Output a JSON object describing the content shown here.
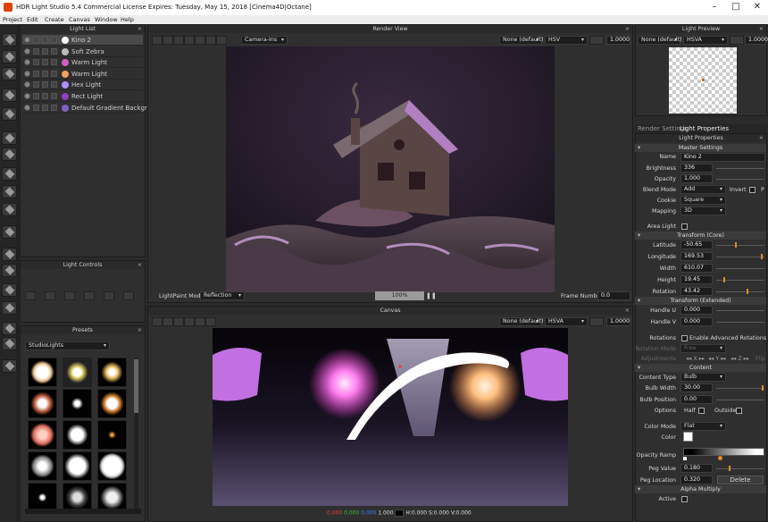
{
  "window": {
    "title": "HDR Light Studio 5.4 Commercial License Expires: Tuesday, May 15, 2018  [Cinema4D|Octane]"
  },
  "menu": [
    "Project",
    "Edit",
    "Create",
    "Canvas",
    "Window",
    "Help"
  ],
  "light_list": {
    "title": "Light List",
    "items": [
      {
        "name": "Kino 2",
        "color": "#ffffff",
        "selected": true
      },
      {
        "name": "Soft Zebra",
        "color": "#bbbbbb",
        "selected": false
      },
      {
        "name": "Warm Light",
        "color": "#d060c0",
        "selected": false
      },
      {
        "name": "Warm Light",
        "color": "#f0a060",
        "selected": false
      },
      {
        "name": "Hex Light",
        "color": "#b090ff",
        "selected": false
      },
      {
        "name": "Rect Light",
        "color": "#9040c0",
        "selected": false
      },
      {
        "name": "Default Gradient Background",
        "color": "#8060c0",
        "selected": false
      }
    ]
  },
  "light_controls": {
    "title": "Light Controls"
  },
  "presets": {
    "title": "Presets",
    "category": "StudioLights"
  },
  "render_view": {
    "title": "Render View",
    "camera": "Camera-Ins",
    "lut": "None (default)",
    "colorspace": "HSV",
    "exposure": "1.0000",
    "lightpaint_label": "LightPaint Mode",
    "lightpaint_mode": "Reflection",
    "progress": "100%",
    "frame_label": "Frame Number",
    "frame_value": "0.0"
  },
  "canvas": {
    "title": "Canvas",
    "lut": "None (default)",
    "colorspace": "HSVA",
    "exposure": "1.0000",
    "readout_r": "0.000",
    "readout_g": "0.000",
    "readout_b": "0.000",
    "readout_a": "1.000",
    "readout_hsv": "H:0.000 S:0.000 V:0.000"
  },
  "light_preview": {
    "title": "Light Preview",
    "lut": "None (default)",
    "colorspace": "HSVA",
    "exposure": "1.0000"
  },
  "tabs": [
    "Render Settings",
    "Light Properties"
  ],
  "props": {
    "title": "Light Properties",
    "master": "Master Settings",
    "name_label": "Name",
    "name": "Kino 2",
    "brightness_label": "Brightness",
    "brightness": "336",
    "opacity_label": "Opacity",
    "opacity": "1.000",
    "blend_label": "Blend Mode",
    "blend": "Add",
    "invert_label": "Invert",
    "p_label": "P",
    "cookie_label": "Cookie",
    "cookie": "Square",
    "mapping_label": "Mapping",
    "mapping": "3D",
    "area_label": "Area Light",
    "transform_core": "Transform (Core)",
    "lat_label": "Latitude",
    "lat": "-50.65",
    "lon_label": "Longitude",
    "lon": "169.53",
    "width_label": "Width",
    "width": "610.07",
    "height_label": "Height",
    "height": "19.45",
    "rot_label": "Rotation",
    "rot": "43.42",
    "transform_ext": "Transform (Extended)",
    "hu_label": "Handle U",
    "hu": "0.000",
    "hv_label": "Handle V",
    "hv": "0.000",
    "rotations_label": "Rotations",
    "adv_label": "Enable Advanced Rotations",
    "rotmode_label": "Rotation Mode",
    "rotmode": "Free",
    "adjust_label": "Adjustments",
    "adj_x": "X",
    "adj_y": "Y",
    "adj_z": "Z",
    "adj_flip": "Flip",
    "content": "Content",
    "ctype_label": "Content Type",
    "ctype": "Bulb",
    "bw_label": "Bulb Width",
    "bw": "30.00",
    "bp_label": "Bulb Position",
    "bp": "0.00",
    "options_label": "Options",
    "half_label": "Half",
    "outside_label": "Outside",
    "cmode_label": "Color Mode",
    "cmode": "Flat",
    "color_label": "Color",
    "oramp_label": "Opacity Ramp",
    "pv_label": "Peg Value",
    "pv": "0.180",
    "pl_label": "Peg Location",
    "pl": "0.320",
    "delete_label": "Delete",
    "alpha": "Alpha Multiply",
    "active_label": "Active"
  }
}
